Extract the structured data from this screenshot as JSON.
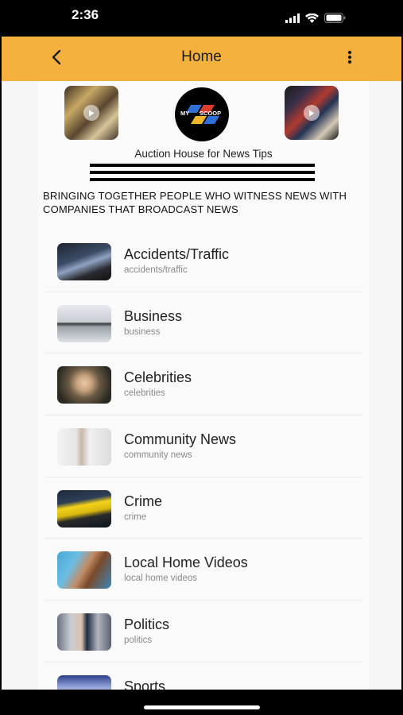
{
  "status_bar": {
    "time": "2:36",
    "icons": [
      "cellular-signal-icon",
      "wifi-icon",
      "battery-icon"
    ]
  },
  "header": {
    "title": "Home",
    "back_icon": "chevron-left-icon",
    "menu_icon": "more-vertical-icon",
    "accent_color": "#f5b13d"
  },
  "hero": {
    "logo_text_left": "MY",
    "logo_text_right": "SCOOP",
    "tagline": "Auction House for News Tips",
    "mission": "BRINGING TOGETHER PEOPLE WHO WITNESS NEWS WITH COMPANIES THAT BROADCAST NEWS"
  },
  "categories": [
    {
      "title": "Accidents/Traffic",
      "subtitle": "accidents/traffic"
    },
    {
      "title": "Business",
      "subtitle": "business"
    },
    {
      "title": "Celebrities",
      "subtitle": "celebrities"
    },
    {
      "title": "Community News",
      "subtitle": "community news"
    },
    {
      "title": "Crime",
      "subtitle": "crime"
    },
    {
      "title": "Local Home Videos",
      "subtitle": "local home videos"
    },
    {
      "title": "Politics",
      "subtitle": "politics"
    },
    {
      "title": "Sports",
      "subtitle": ""
    }
  ]
}
